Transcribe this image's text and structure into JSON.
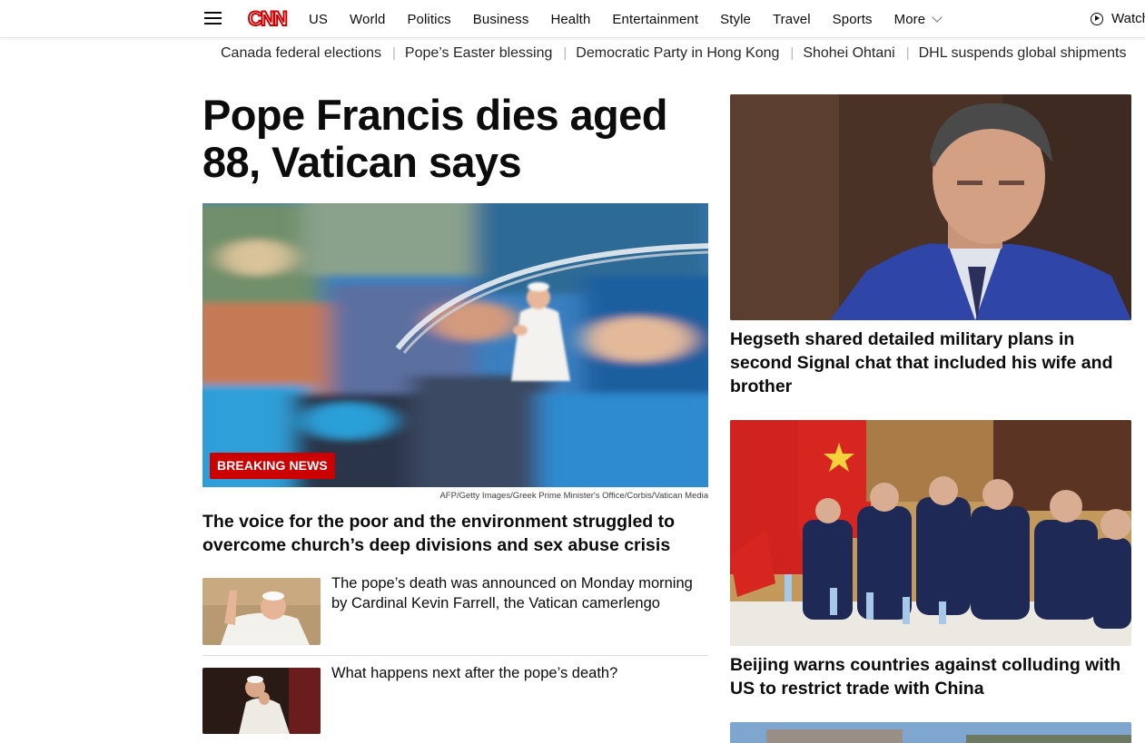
{
  "header": {
    "nav": [
      "US",
      "World",
      "Politics",
      "Business",
      "Health",
      "Entertainment",
      "Style",
      "Travel",
      "Sports"
    ],
    "more_label": "More",
    "watch_label": "Watch"
  },
  "trending": [
    "Canada federal elections",
    "Pope’s Easter blessing",
    "Democratic Party in Hong Kong",
    "Shohei Ohtani",
    "DHL suspends global shipments"
  ],
  "lead": {
    "headline": "Pope Francis dies aged 88, Vatican says",
    "badge": "BREAKING NEWS",
    "credit": "AFP/Getty Images/Greek Prime Minister's Office/Corbis/Vatican Media",
    "subheadline": "The voice for the poor and the environment struggled to overcome church’s deep divisions and sex abuse crisis",
    "related": [
      {
        "text": "The pope’s death was announced on Monday morning by Cardinal Kevin Farrell, the Vatican camerlengo"
      },
      {
        "text": "What happens next after the pope’s death?"
      }
    ]
  },
  "side": [
    {
      "title": "Hegseth shared detailed military plans in second Signal chat that included his wife and brother"
    },
    {
      "title": "Beijing warns countries against colluding with US to restrict trade with China"
    }
  ],
  "colors": {
    "brand": "#cc0000",
    "text": "#0c0c0c",
    "divider": "#e0e0e0"
  }
}
